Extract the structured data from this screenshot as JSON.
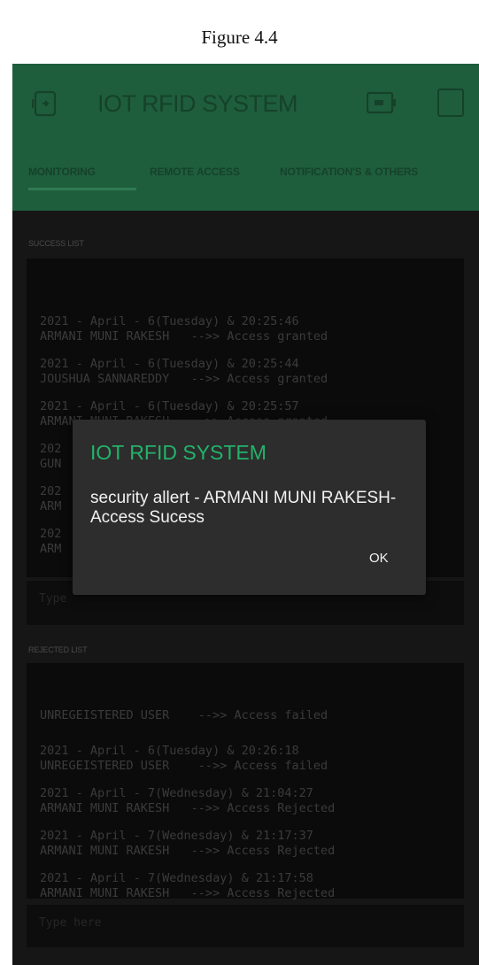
{
  "figure_caption": "Figure 4.4",
  "app": {
    "title": "IOT RFID SYSTEM"
  },
  "tabs": [
    {
      "label": "MONITORING"
    },
    {
      "label": "REMOTE ACCESS"
    },
    {
      "label": "NOTIFICATION'S & OTHERS"
    }
  ],
  "success_list": {
    "label": "SUCCESS LIST",
    "entries": [
      {
        "line1": "2021 - April - 6(Tuesday) & 20:25:46",
        "line2": "ARMANI MUNI RAKESH   -->> Access granted"
      },
      {
        "line1": "2021 - April - 6(Tuesday) & 20:25:44",
        "line2": "JOUSHUA SANNAREDDY   -->> Access granted"
      },
      {
        "line1": "2021 - April - 6(Tuesday) & 20:25:57",
        "line2": "ARMANI MUNI RAKESH   -->> Access granted"
      },
      {
        "line1": "202",
        "line2": "GUN"
      },
      {
        "line1": "202",
        "line2": "ARM"
      },
      {
        "line1": "202",
        "line2": "ARM"
      }
    ],
    "input_placeholder": "Type"
  },
  "rejected_list": {
    "label": "REJECTED LIST",
    "entries": [
      {
        "line1": "UNREGEISTERED USER    -->> Access failed",
        "line2": ""
      },
      {
        "line1": "2021 - April - 6(Tuesday) & 20:26:18",
        "line2": "UNREGEISTERED USER    -->> Access failed"
      },
      {
        "line1": "2021 - April - 7(Wednesday) & 21:04:27",
        "line2": "ARMANI MUNI RAKESH   -->> Access Rejected"
      },
      {
        "line1": "2021 - April - 7(Wednesday) & 21:17:37",
        "line2": "ARMANI MUNI RAKESH   -->> Access Rejected"
      },
      {
        "line1": "2021 - April - 7(Wednesday) & 21:17:58",
        "line2": "ARMANI MUNI RAKESH   -->> Access Rejected"
      }
    ],
    "input_placeholder": "Type here"
  },
  "dialog": {
    "title": "IOT RFID SYSTEM",
    "message": "security allert - ARMANI MUNI RAKESH-Access Sucess",
    "ok_label": "OK"
  },
  "icons": {
    "back": "device-back-icon",
    "battery": "battery-icon",
    "menu": "square-icon"
  },
  "colors": {
    "appbar": "#1e5e3c",
    "dialog_title": "#22b36a",
    "dialog_bg": "#2d2d2d",
    "screen_bg": "#161616"
  }
}
